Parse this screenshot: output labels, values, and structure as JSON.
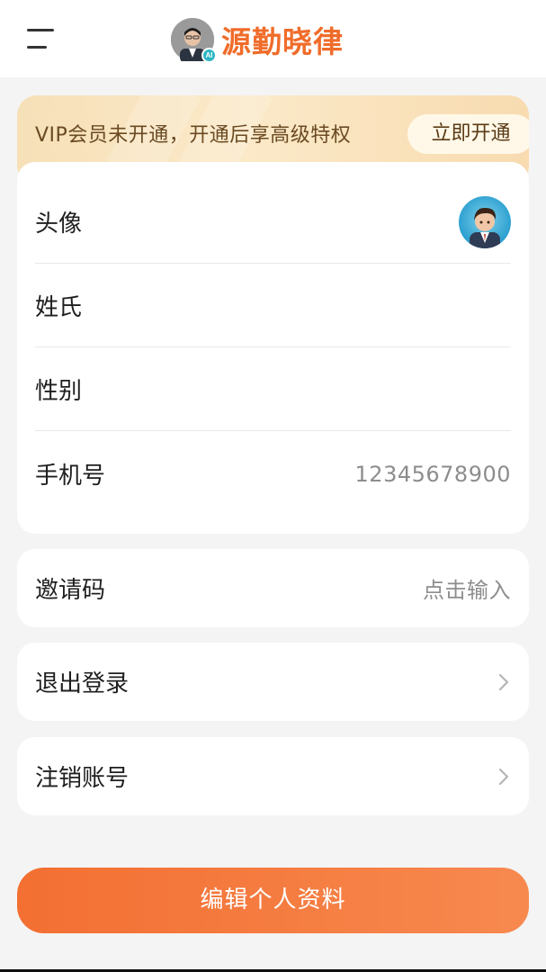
{
  "header": {
    "menu_icon": "menu-icon",
    "brand_avatar_badge": "AI",
    "brand_title": "源勤晓律"
  },
  "vip": {
    "text": "VIP会员未开通，开通后享高级特权",
    "button_label": "立即开通"
  },
  "profile": {
    "avatar_label": "头像",
    "surname_label": "姓氏",
    "surname_value": "",
    "gender_label": "性别",
    "gender_value": "",
    "phone_label": "手机号",
    "phone_value": "12345678900"
  },
  "invite": {
    "label": "邀请码",
    "placeholder": "点击输入"
  },
  "logout": {
    "label": "退出登录"
  },
  "deactivate": {
    "label": "注销账号"
  },
  "edit_button": {
    "label": "编辑个人资料"
  },
  "colors": {
    "accent": "#f36f32",
    "brand": "#f06c2a",
    "vip_bg": "#f8dfb6"
  }
}
